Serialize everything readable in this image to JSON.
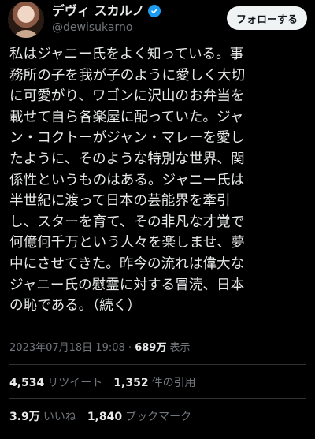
{
  "author": {
    "display_name": "デヴィ スカルノ",
    "handle": "@dewisukarno",
    "verified_icon": "verified-badge-icon",
    "avatar_icon": "profile-avatar"
  },
  "follow_label": "フォローする",
  "body_lines": [
    "私はジャニー氏をよく知っている。事",
    "務所の子を我が子のように愛しく大切",
    "に可愛がり、ワゴンに沢山のお弁当を",
    "載せて自ら各楽屋に配っていた。ジャ",
    "ン・コクトーがジャン・マレーを愛し",
    "たように、そのような特別な世界、関",
    "係性というものはある。ジャニー氏は",
    "半世紀に渡って日本の芸能界を牽引",
    "し、スターを育て、その非凡な才覚で",
    "何億何千万という人々を楽しませ、夢",
    "中にさせてきた。昨今の流れは偉大な",
    "ジャニー氏の慰霊に対する冒涜、日本",
    "の恥である。（続く）"
  ],
  "meta": {
    "timestamp": "2023年07月18日 19:08",
    "separator": "·",
    "views_count": "689万",
    "views_label": "表示"
  },
  "stats": {
    "retweets_count": "4,534",
    "retweets_label": "リツイート",
    "quotes_count": "1,352",
    "quotes_label": "件の引用",
    "likes_count": "3.9万",
    "likes_label": "いいね",
    "bookmarks_count": "1,840",
    "bookmarks_label": "ブックマーク"
  },
  "colors": {
    "background": "#000000",
    "text": "#e7e9ea",
    "secondary": "#71767b",
    "accent": "#1d9bf0",
    "divider": "#2f3336"
  }
}
